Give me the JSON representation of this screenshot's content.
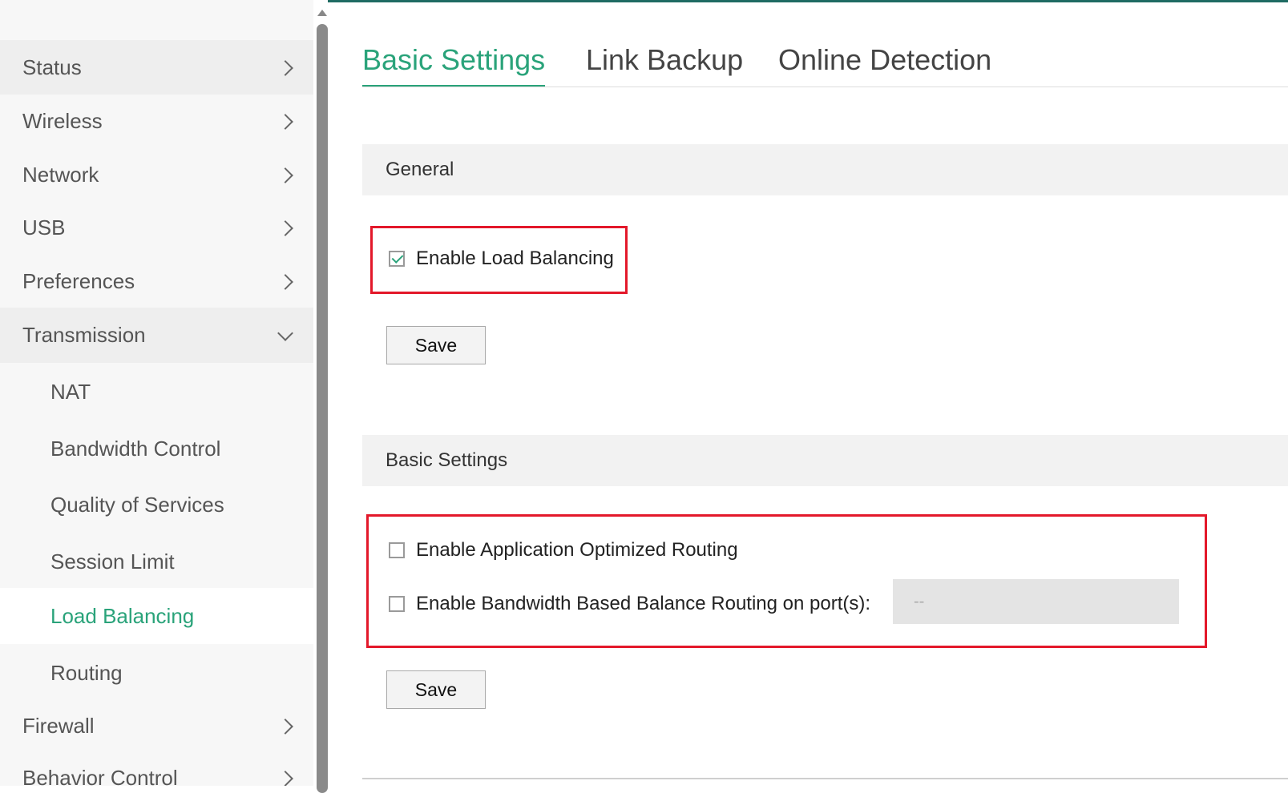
{
  "sidebar": {
    "items": [
      {
        "label": "Status",
        "icon": "chevron-right-icon"
      },
      {
        "label": "Wireless",
        "icon": "chevron-right-icon"
      },
      {
        "label": "Network",
        "icon": "chevron-right-icon"
      },
      {
        "label": "USB",
        "icon": "chevron-right-icon"
      },
      {
        "label": "Preferences",
        "icon": "chevron-right-icon"
      },
      {
        "label": "Transmission",
        "icon": "chevron-down-icon",
        "expanded": true
      },
      {
        "label": "NAT"
      },
      {
        "label": "Bandwidth Control"
      },
      {
        "label": "Quality of Services"
      },
      {
        "label": "Session Limit"
      },
      {
        "label": "Load Balancing",
        "active": true
      },
      {
        "label": "Routing"
      },
      {
        "label": "Firewall",
        "icon": "chevron-right-icon"
      },
      {
        "label": "Behavior Control",
        "icon": "chevron-right-icon"
      }
    ]
  },
  "tabs": [
    {
      "label": "Basic Settings",
      "active": true
    },
    {
      "label": "Link Backup"
    },
    {
      "label": "Online Detection"
    }
  ],
  "general": {
    "header": "General",
    "enable_load_balancing": {
      "label": "Enable Load Balancing",
      "checked": true
    },
    "save_label": "Save"
  },
  "basic_settings": {
    "header": "Basic Settings",
    "app_optimized_routing": {
      "label": "Enable Application Optimized Routing",
      "checked": false
    },
    "bandwidth_balance_routing": {
      "label": "Enable Bandwidth Based Balance Routing on port(s):",
      "checked": false
    },
    "ports_value": "--",
    "save_label": "Save"
  },
  "colors": {
    "accent": "#2aa37a",
    "highlight": "#e3182a",
    "top_bar": "#1f6b63"
  }
}
